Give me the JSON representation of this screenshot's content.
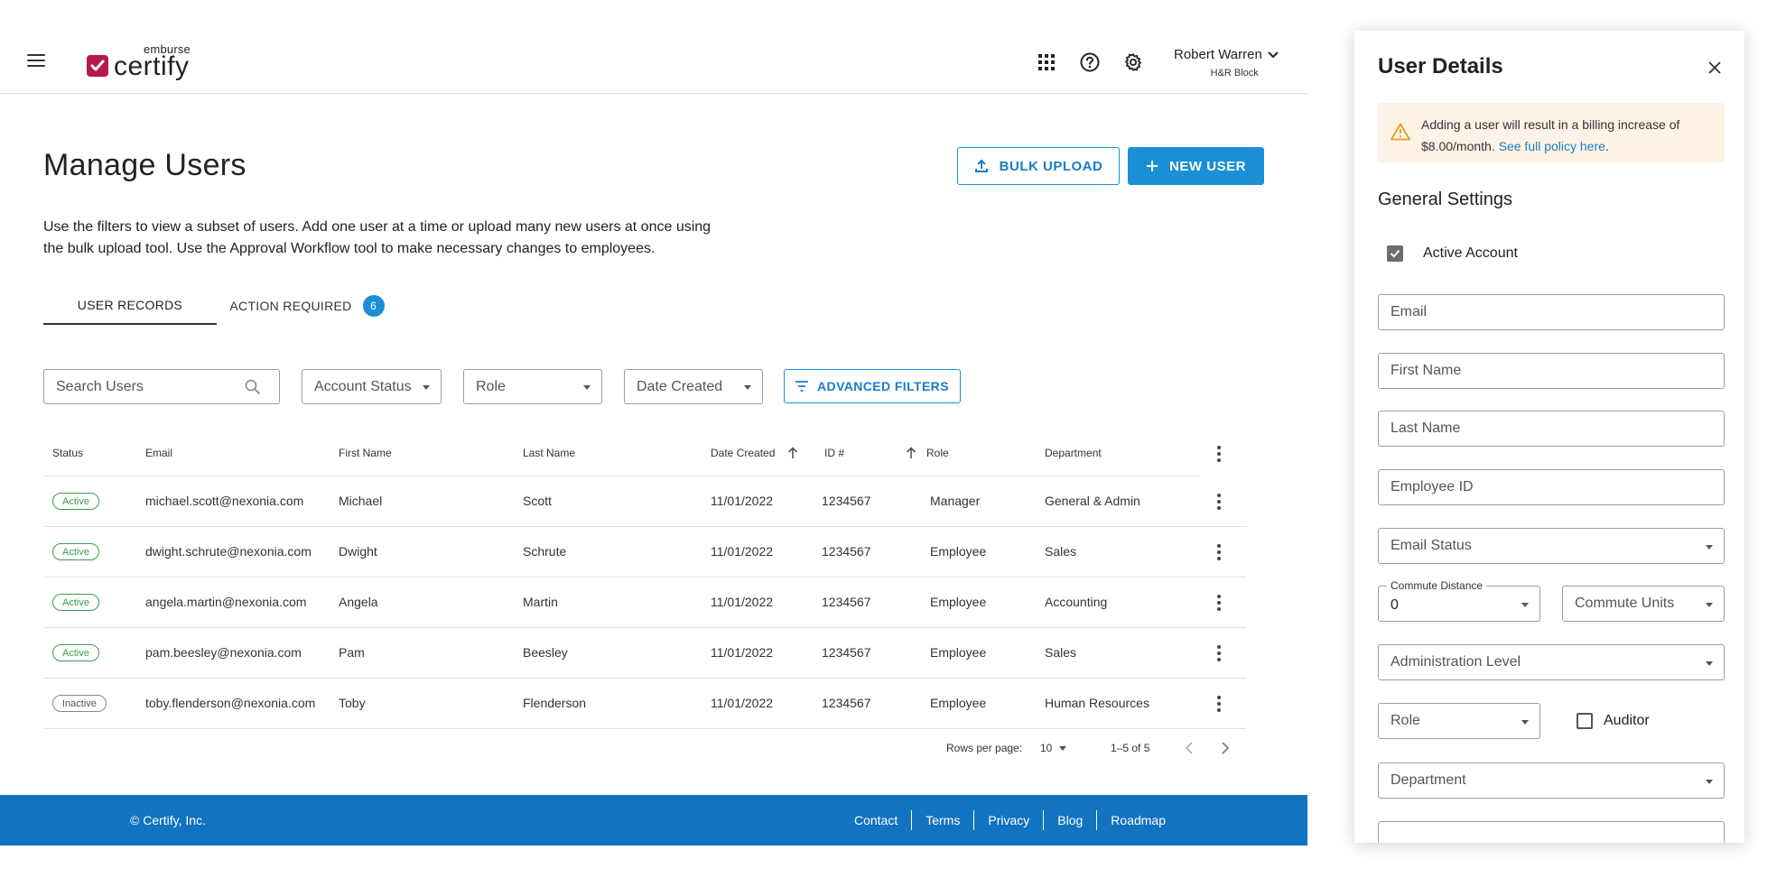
{
  "header": {
    "brand_sup": "emburse",
    "brand_main": "certify",
    "user_name": "Robert Warren",
    "user_company": "H&R Block"
  },
  "page": {
    "title": "Manage Users",
    "description": "Use the filters to view a subset of users. Add one user at a time or upload many new users at once using the bulk upload tool. Use the Approval Workflow tool to make necessary changes to employees.",
    "bulk_upload_label": "BULK UPLOAD",
    "new_user_label": "NEW USER"
  },
  "tabs": [
    {
      "label": "USER RECORDS",
      "active": true
    },
    {
      "label": "ACTION REQUIRED",
      "badge": "6",
      "active": false
    }
  ],
  "filters": {
    "search_placeholder": "Search Users",
    "account_status": "Account Status",
    "role": "Role",
    "date_created": "Date Created",
    "advanced": "ADVANCED FILTERS"
  },
  "table": {
    "columns": [
      "Status",
      "Email",
      "First Name",
      "Last Name",
      "Date Created",
      "ID #",
      "Role",
      "Department"
    ],
    "rows": [
      {
        "status": "Active",
        "email": "michael.scott@nexonia.com",
        "first": "Michael",
        "last": "Scott",
        "date": "11/01/2022",
        "id": "1234567",
        "role": "Manager",
        "dept": "General & Admin"
      },
      {
        "status": "Active",
        "email": "dwight.schrute@nexonia.com",
        "first": "Dwight",
        "last": "Schrute",
        "date": "11/01/2022",
        "id": "1234567",
        "role": "Employee",
        "dept": "Sales"
      },
      {
        "status": "Active",
        "email": "angela.martin@nexonia.com",
        "first": "Angela",
        "last": "Martin",
        "date": "11/01/2022",
        "id": "1234567",
        "role": "Employee",
        "dept": "Accounting"
      },
      {
        "status": "Active",
        "email": "pam.beesley@nexonia.com",
        "first": "Pam",
        "last": "Beesley",
        "date": "11/01/2022",
        "id": "1234567",
        "role": "Employee",
        "dept": "Sales"
      },
      {
        "status": "Inactive",
        "email": "toby.flenderson@nexonia.com",
        "first": "Toby",
        "last": "Flenderson",
        "date": "11/01/2022",
        "id": "1234567",
        "role": "Employee",
        "dept": "Human Resources"
      }
    ]
  },
  "pagination": {
    "rows_per_page_label": "Rows per page:",
    "rows_per_page": "10",
    "range": "1–5 of 5"
  },
  "footer": {
    "copyright": "© Certify, Inc.",
    "links": [
      "Contact",
      "Terms",
      "Privacy",
      "Blog",
      "Roadmap"
    ]
  },
  "drawer": {
    "title": "User Details",
    "alert_text": "Adding a user will result in a billing increase of $8.00/month.",
    "alert_link": "See full policy here",
    "alert_end": ".",
    "section_title": "General Settings",
    "active_account_label": "Active Account",
    "email_placeholder": "Email",
    "first_name_placeholder": "First Name",
    "last_name_placeholder": "Last Name",
    "employee_id_placeholder": "Employee ID",
    "email_status": "Email Status",
    "commute_distance_label": "Commute Distance",
    "commute_distance_value": "0",
    "commute_units": "Commute Units",
    "administration_level": "Administration Level",
    "role": "Role",
    "auditor_label": "Auditor",
    "department": "Department"
  },
  "colors": {
    "primary": "#1a8fd6",
    "footer": "#1273c0",
    "brand": "#b8194f",
    "active_green": "#3a9c4e",
    "alert_bg": "#fdf3e6",
    "warning": "#e0a020"
  }
}
